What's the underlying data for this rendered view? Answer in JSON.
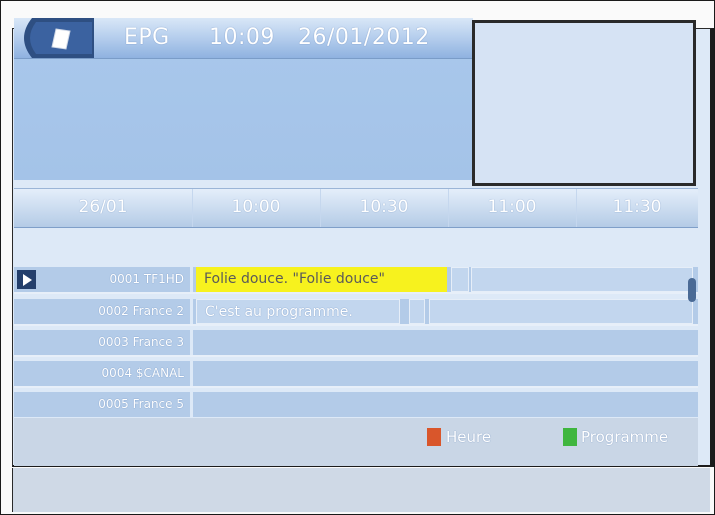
{
  "header": {
    "title": "EPG",
    "time": "10:09",
    "date": "26/01/2012"
  },
  "timeline": {
    "date": "26/01",
    "slots": [
      "10:00",
      "10:30",
      "11:00",
      "11:30"
    ]
  },
  "channels": [
    {
      "name": "0001 TF1HD",
      "selected": true,
      "programs": [
        {
          "title": "Folie douce.  \"Folie douce\"",
          "highlighted": true
        }
      ]
    },
    {
      "name": "0002 France 2",
      "selected": false,
      "programs": [
        {
          "title": "C'est au programme.",
          "highlighted": false
        }
      ]
    },
    {
      "name": "0003 France 3",
      "selected": false,
      "programs": []
    },
    {
      "name": "0004 $CANAL",
      "selected": false,
      "programs": []
    },
    {
      "name": "0005 France 5",
      "selected": false,
      "programs": []
    }
  ],
  "legend": {
    "red_label": "Heure",
    "green_label": "Programme"
  },
  "colors": {
    "highlight": "#f7f21e",
    "red_key": "#d9562b",
    "green_key": "#3fb63f",
    "selector": "#243f6c"
  },
  "icons": {
    "tab": "epg-tab-icon",
    "selector": "play-arrow-icon"
  }
}
